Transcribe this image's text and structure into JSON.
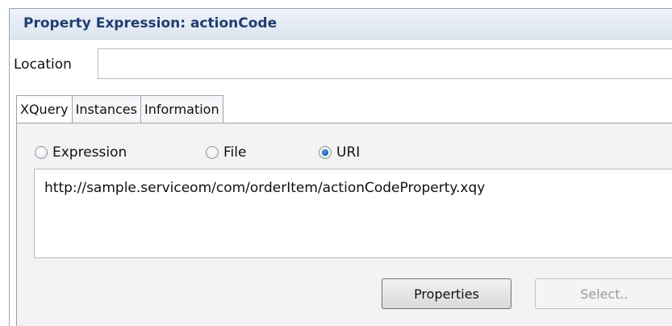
{
  "dialog": {
    "title": "Property Expression: actionCode"
  },
  "location": {
    "label": "Location",
    "value": "",
    "placeholder": ""
  },
  "tabs": [
    {
      "label": "XQuery",
      "active": true
    },
    {
      "label": "Instances",
      "active": false
    },
    {
      "label": "Information",
      "active": false
    }
  ],
  "source_options": [
    {
      "label": "Expression",
      "checked": false
    },
    {
      "label": "File",
      "checked": false
    },
    {
      "label": "URI",
      "checked": true
    }
  ],
  "uri_text": "http://sample.serviceom/com/orderItem/actionCodeProperty.xqy",
  "buttons": {
    "properties": {
      "label": "Properties",
      "enabled": true
    },
    "select": {
      "label": "Select..",
      "enabled": false
    }
  },
  "colors": {
    "title_text": "#1f3e6f",
    "title_bar": "#e4eaf3",
    "panel_bg": "#f3f3f3",
    "radio_checked": "#1f5fb0"
  }
}
